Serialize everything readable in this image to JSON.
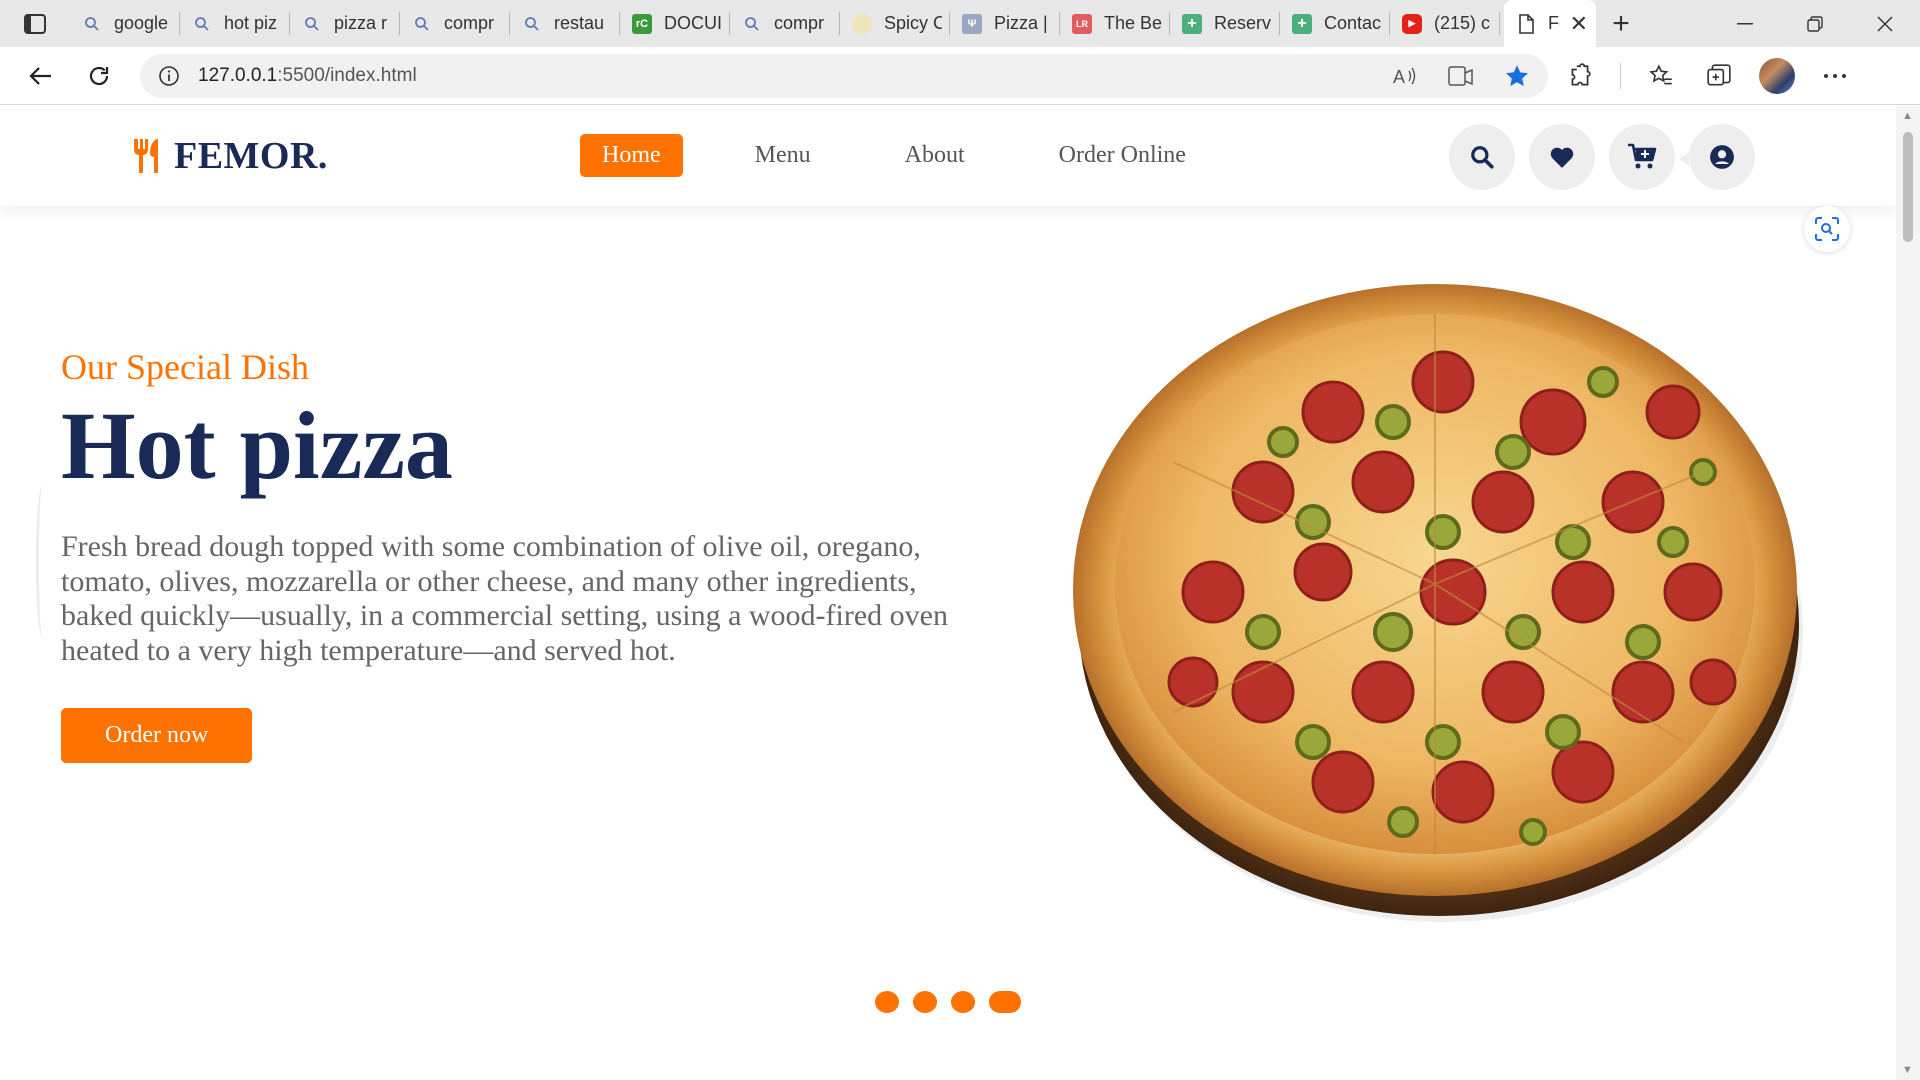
{
  "browser": {
    "tabs": [
      {
        "label": "google",
        "icon": "search-icon"
      },
      {
        "label": "hot piz",
        "icon": "search-icon"
      },
      {
        "label": "pizza r",
        "icon": "search-icon"
      },
      {
        "label": "compr",
        "icon": "search-icon"
      },
      {
        "label": "restau",
        "icon": "search-icon"
      },
      {
        "label": "DOCUI",
        "icon": "rc-icon"
      },
      {
        "label": "compr",
        "icon": "search-icon"
      },
      {
        "label": "Spicy C",
        "icon": "spicy-icon"
      },
      {
        "label": "Pizza |",
        "icon": "pizza-site-icon"
      },
      {
        "label": "The Be",
        "icon": "lr-icon"
      },
      {
        "label": "Reserv",
        "icon": "plus-square-icon"
      },
      {
        "label": "Contac",
        "icon": "plus-square-icon"
      },
      {
        "label": "(215) c",
        "icon": "youtube-icon"
      }
    ],
    "active_tab": {
      "label": "Fe",
      "icon": "page-icon"
    },
    "url_host": "127.0.0.1",
    "url_path": ":5500/index.html"
  },
  "site": {
    "logo": "FEMOR.",
    "nav": [
      "Home",
      "Menu",
      "About",
      "Order Online"
    ],
    "active_nav": "Home",
    "header_icons": [
      "search-icon",
      "heart-icon",
      "cart-icon",
      "user-icon"
    ]
  },
  "hero": {
    "subtitle": "Our Special Dish",
    "title": "Hot pizza",
    "description": "Fresh bread dough topped with some combination of olive oil, oregano, tomato, olives, mozzarella or other cheese, and many other ingredients, baked quickly—usually, in a commercial setting, using a wood-fired oven heated to a very high temperature—and served hot.",
    "button": "Order now",
    "slides": 4,
    "active_slide": 4
  },
  "colors": {
    "accent": "#ff7200",
    "brand": "#192a56",
    "text": "#666666"
  }
}
